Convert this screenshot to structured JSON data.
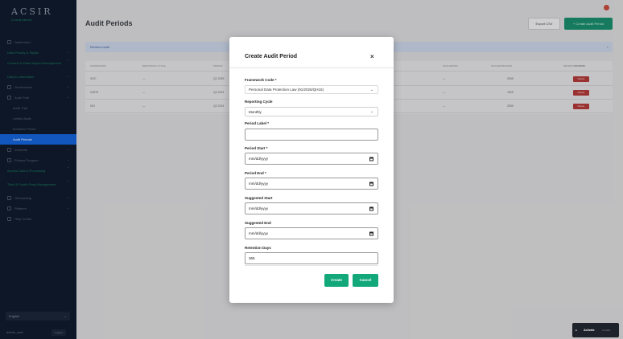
{
  "sidebar": {
    "logo_main": "ACSIR",
    "logo_sub": "Compliance",
    "items": [
      {
        "label": "Dashboard",
        "style": "ico"
      },
      {
        "label": "Data Privacy & Rights",
        "style": "green"
      },
      {
        "label": "Consent & Data Subject Management",
        "style": "green-two"
      },
      {
        "label": "Data & Information",
        "style": "green"
      },
      {
        "label": "Governance",
        "style": "ico-chev"
      },
      {
        "label": "Audit Trail",
        "style": "ico-chev"
      },
      {
        "label": "Audit Trail",
        "style": "sub"
      },
      {
        "label": "Unified Audit",
        "style": "sub"
      },
      {
        "label": "Evidence Packs",
        "style": "sub"
      },
      {
        "label": "Audit Periods",
        "style": "active"
      },
      {
        "label": "Incidents",
        "style": "ico-chev"
      },
      {
        "label": "Privacy Program",
        "style": "ico-chev"
      },
      {
        "label": "Access Data & Processing",
        "style": "green-two"
      },
      {
        "label": "Third & Fourth Party Management",
        "style": "green-two"
      },
      {
        "label": "Onboarding",
        "style": "ico-chev"
      },
      {
        "label": "Platform",
        "style": "ico-chev"
      },
      {
        "label": "Help Center",
        "style": "ico"
      }
    ],
    "language": "English",
    "user": "admin_user",
    "logout": "Logout"
  },
  "main": {
    "title": "Audit Periods",
    "export_label": "Export CSV",
    "create_label": "+ Create Audit Period",
    "filter_label": "Review mode",
    "table": {
      "headers": [
        "FRAMEWORK",
        "REPORTING CYCLE",
        "PERIOD",
        "",
        "",
        "SUGGESTED",
        "SUGGESTED END",
        "RETENTION DAYS",
        "ACTIONS"
      ],
      "rows": [
        {
          "framework": "SOC",
          "cycle": "—",
          "period": "Q1 2025",
          "suggested": "—",
          "retention": "2555",
          "action": "Delete"
        },
        {
          "framework": "GDPR",
          "cycle": "—",
          "period": "Q3 2024",
          "suggested": "—",
          "retention": "1825",
          "action": "Delete"
        },
        {
          "framework": "ISO",
          "cycle": "—",
          "period": "Q2 2024",
          "suggested": "—",
          "retention": "2555",
          "action": "Delete"
        }
      ]
    }
  },
  "modal": {
    "title": "Create Audit Period",
    "close_symbol": "×",
    "framework_label": "Framework Code *",
    "framework_value": "Personal Data Protection Law (91/2025/QH15)",
    "cycle_label": "Reporting Cycle",
    "cycle_value": "Monthly",
    "period_label_label": "Period Label *",
    "period_label_value": "",
    "period_start_label": "Period Start *",
    "period_start_value": "mm/dd/yyyy",
    "period_end_label": "Period End *",
    "period_end_value": "mm/dd/yyyy",
    "suggested_start_label": "Suggested Start",
    "suggested_start_value": "mm/dd/yyyy",
    "suggested_end_label": "Suggested End",
    "suggested_end_value": "mm/dd/yyyy",
    "retention_label": "Retention Days",
    "retention_value": "365",
    "create_label": "Create",
    "cancel_label": "Cancel"
  },
  "toast": {
    "label": "Activate",
    "meta": "to finish"
  }
}
